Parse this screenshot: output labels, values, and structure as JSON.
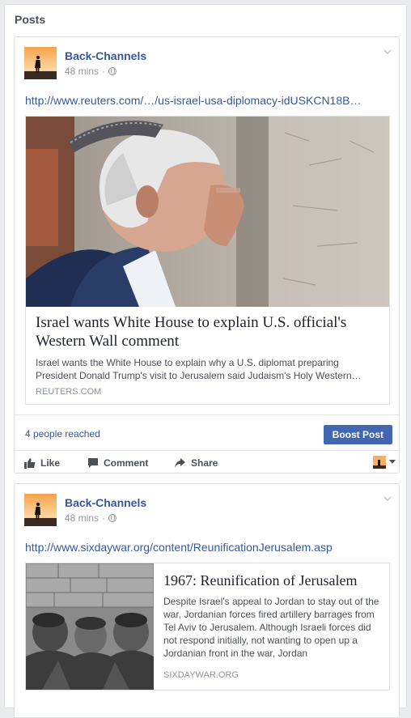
{
  "section_title": "Posts",
  "posts": [
    {
      "author": "Back-Channels",
      "time": "48 mins",
      "separator": "·",
      "link": "http://www.reuters.com/…/us-israel-usa-diplomacy-idUSKCN18B…",
      "card": {
        "title": "Israel wants White House to explain U.S. official's Western Wall comment",
        "description": "Israel wants the White House to explain why a U.S. diplomat preparing President Donald Trump's visit to Jerusalem said Judaism's Holy Western…",
        "domain": "REUTERS.COM"
      },
      "reached": "4 people reached",
      "boost_label": "Boost Post",
      "actions": {
        "like": "Like",
        "comment": "Comment",
        "share": "Share"
      }
    },
    {
      "author": "Back-Channels",
      "time": "48 mins",
      "separator": "·",
      "link": "http://www.sixdaywar.org/content/ReunificationJerusalem.asp",
      "card": {
        "title": "1967: Reunification of Jerusalem",
        "description": "Despite Israel's appeal to Jordan to stay out of the war, Jordanian forces fired artillery barrages from Tel Aviv to Jerusalem. Although Israeli forces did not respond initially, not wanting to open up a Jordanian front in the war, Jordan",
        "domain": "SIXDAYWAR.ORG"
      }
    }
  ],
  "colors": {
    "link": "#365899",
    "boost": "#4267b2",
    "muted": "#90949c"
  }
}
